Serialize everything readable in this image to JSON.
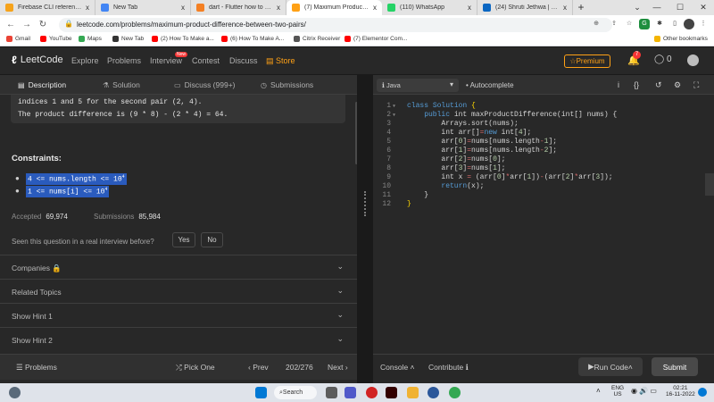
{
  "browser": {
    "tabs": [
      {
        "label": "Firebase CLI reference | Fir",
        "fav_color": "#f6a31b",
        "active": false
      },
      {
        "label": "New Tab",
        "fav_color": "#4285f4",
        "active": false
      },
      {
        "label": "dart - Flutter how to progr",
        "fav_color": "#f48024",
        "active": false
      },
      {
        "label": "(7) Maximum Product Diffe",
        "fav_color": "#ffa116",
        "active": true
      },
      {
        "label": "(110) WhatsApp",
        "fav_color": "#25d366",
        "active": false
      },
      {
        "label": "(24) Shruti Jethwa | LinkedI",
        "fav_color": "#0a66c2",
        "active": false
      }
    ],
    "tab_close": "x",
    "new_tab": "+",
    "url": "leetcode.com/problems/maximum-product-difference-between-two-pairs/",
    "bookmarks": [
      {
        "label": "Gmail",
        "color": "#ea4335"
      },
      {
        "label": "YouTube",
        "color": "#ff0000"
      },
      {
        "label": "Maps",
        "color": "#34a853"
      },
      {
        "label": "New Tab",
        "color": "#333333"
      },
      {
        "label": "(2) How To Make a...",
        "color": "#ff0000"
      },
      {
        "label": "(6) How To Make A...",
        "color": "#ff0000"
      },
      {
        "label": "Citrix Receiver",
        "color": "#555555"
      },
      {
        "label": "(7) Elementor Com...",
        "color": "#ff0000"
      }
    ],
    "other_bookmarks": "Other bookmarks"
  },
  "leetcode_nav": {
    "logo": "LeetCode",
    "links": [
      "Explore",
      "Problems",
      "Interview",
      "Contest",
      "Discuss",
      "Store"
    ],
    "new_badge": "New",
    "premium": "Premium",
    "notifications": "7",
    "coins": "0"
  },
  "left_panel": {
    "tabs": [
      "Description",
      "Solution",
      "Discuss (999+)",
      "Submissions"
    ],
    "example_lines": [
      "indices 1 and 5 for the second pair (2, 4).",
      "The product difference is (9 * 8) - (2 * 4) = 64."
    ],
    "constraints_title": "Constraints:",
    "constraints": [
      {
        "text": "4 <= nums.length <= 10",
        "sup": "4"
      },
      {
        "text": "1 <= nums[i] <= 10",
        "sup": "4"
      }
    ],
    "accepted_label": "Accepted",
    "accepted_value": "69,974",
    "submissions_label": "Submissions",
    "submissions_value": "85,984",
    "interview_question": "Seen this question in a real interview before?",
    "yes": "Yes",
    "no": "No",
    "sections": [
      "Companies",
      "Related Topics",
      "Show Hint 1",
      "Show Hint 2"
    ],
    "footer": {
      "problems": "Problems",
      "pick_one": "Pick One",
      "prev": "Prev",
      "page": "202/276",
      "next": "Next"
    }
  },
  "editor": {
    "language": "Java",
    "autocomplete": "Autocomplete",
    "code": [
      {
        "n": "1",
        "fold": true,
        "html": "<span class=\"kw\">class</span> <span class=\"kw\">Solution</span> <span class=\"brk\">{</span>"
      },
      {
        "n": "2",
        "fold": true,
        "html": "    <span class=\"kw\">public</span> int maxProductDifference(int[] nums) {"
      },
      {
        "n": "3",
        "fold": false,
        "html": "        Arrays.sort(nums);"
      },
      {
        "n": "4",
        "fold": false,
        "html": "        int arr[]<span class=\"op\">=</span><span class=\"kw\">new</span> int[<span class=\"num\">4</span>];"
      },
      {
        "n": "5",
        "fold": false,
        "html": "        arr[<span class=\"num\">0</span>]<span class=\"op\">=</span>nums[nums.length<span class=\"op\">-</span><span class=\"num\">1</span>];"
      },
      {
        "n": "6",
        "fold": false,
        "html": "        arr[<span class=\"num\">1</span>]<span class=\"op\">=</span>nums[nums.length<span class=\"op\">-</span><span class=\"num\">2</span>];"
      },
      {
        "n": "7",
        "fold": false,
        "html": "        arr[<span class=\"num\">2</span>]<span class=\"op\">=</span>nums[<span class=\"num\">0</span>];"
      },
      {
        "n": "8",
        "fold": false,
        "html": "        arr[<span class=\"num\">3</span>]<span class=\"op\">=</span>nums[<span class=\"num\">1</span>];"
      },
      {
        "n": "9",
        "fold": false,
        "html": "        int x <span class=\"op\">=</span> (arr[<span class=\"num\">0</span>]<span class=\"op\">*</span>arr[<span class=\"num\">1</span>])<span class=\"op\">-</span>(arr[<span class=\"num\">2</span>]<span class=\"op\">*</span>arr[<span class=\"num\">3</span>]);"
      },
      {
        "n": "10",
        "fold": false,
        "html": "        <span class=\"kw\">return</span>(x);"
      },
      {
        "n": "11",
        "fold": false,
        "html": "    }"
      },
      {
        "n": "12",
        "fold": false,
        "html": "<span class=\"brk\">}</span>"
      }
    ],
    "footer": {
      "console": "Console",
      "contribute": "Contribute",
      "run": "Run Code",
      "submit": "Submit"
    }
  },
  "taskbar": {
    "search": "Search",
    "lang_line1": "ENG",
    "lang_line2": "US",
    "time": "02:21",
    "date": "16-11-2022"
  }
}
